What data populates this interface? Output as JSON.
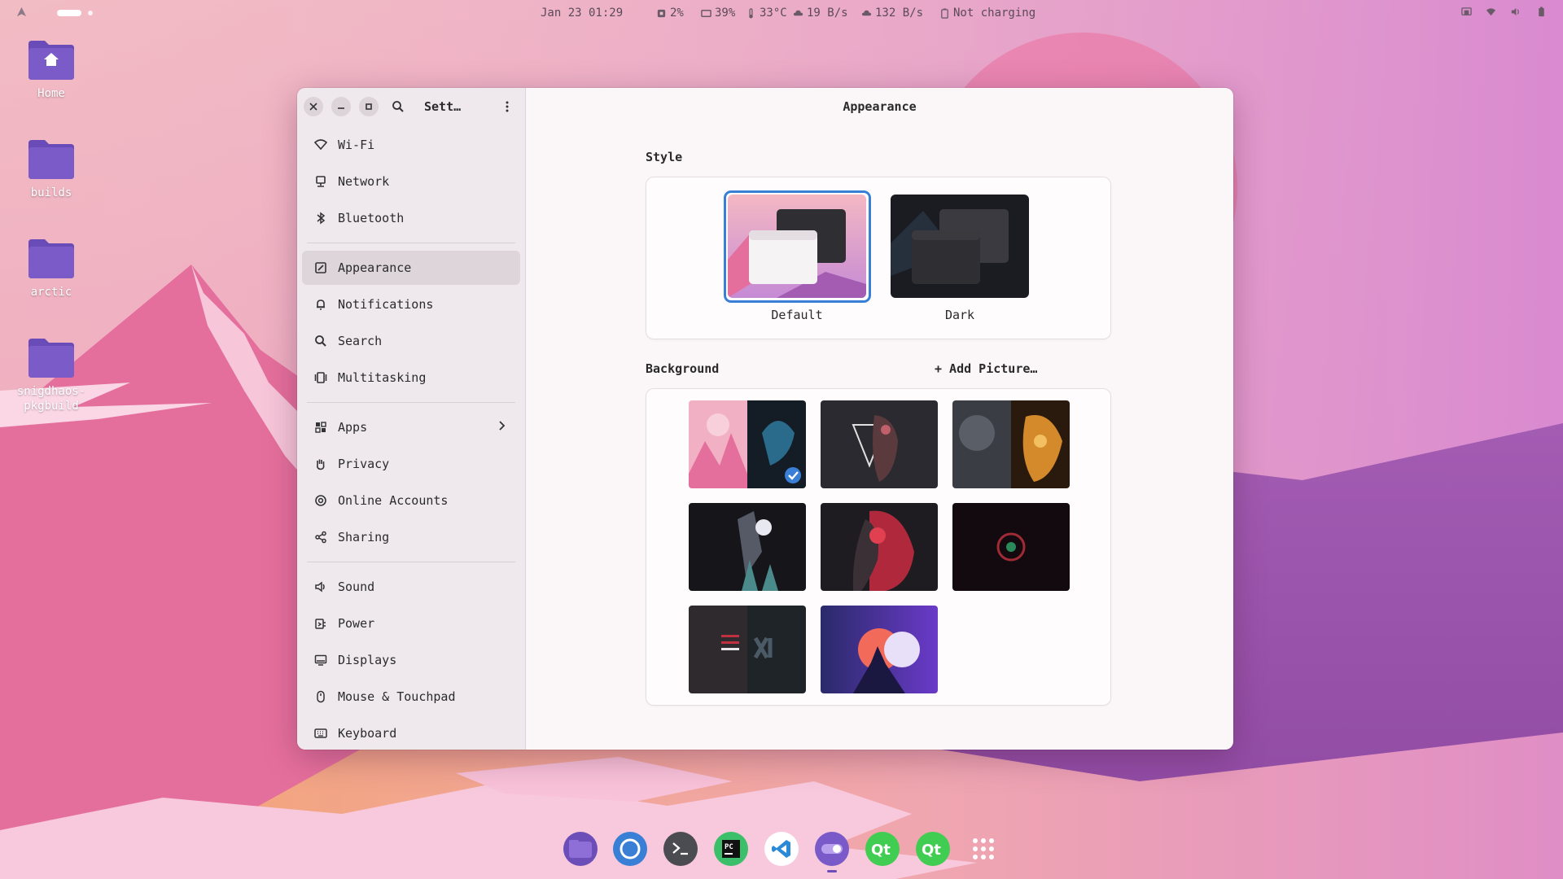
{
  "topbar": {
    "datetime": "Jan 23 01:29",
    "cpu": "2%",
    "memory": "39%",
    "temperature": "33°C",
    "download": "19 B/s",
    "upload": "132 B/s",
    "battery_status": "Not charging"
  },
  "desktop": {
    "icons": [
      {
        "label": "Home"
      },
      {
        "label": "builds"
      },
      {
        "label": "arctic"
      },
      {
        "label": "snigdhaos-\npkgbuild"
      }
    ]
  },
  "sidebar": {
    "title": "Sett…",
    "items": [
      {
        "label": "Wi-Fi",
        "icon": "wifi-icon"
      },
      {
        "label": "Network",
        "icon": "network-icon"
      },
      {
        "label": "Bluetooth",
        "icon": "bluetooth-icon"
      },
      {
        "label": "Appearance",
        "icon": "appearance-icon"
      },
      {
        "label": "Notifications",
        "icon": "bell-icon"
      },
      {
        "label": "Search",
        "icon": "search-icon"
      },
      {
        "label": "Multitasking",
        "icon": "multitasking-icon"
      },
      {
        "label": "Apps",
        "icon": "apps-icon"
      },
      {
        "label": "Privacy",
        "icon": "hand-icon"
      },
      {
        "label": "Online Accounts",
        "icon": "at-icon"
      },
      {
        "label": "Sharing",
        "icon": "share-icon"
      },
      {
        "label": "Sound",
        "icon": "speaker-icon"
      },
      {
        "label": "Power",
        "icon": "power-icon"
      },
      {
        "label": "Displays",
        "icon": "display-icon"
      },
      {
        "label": "Mouse & Touchpad",
        "icon": "mouse-icon"
      },
      {
        "label": "Keyboard",
        "icon": "keyboard-icon"
      }
    ]
  },
  "content": {
    "title": "Appearance",
    "style": {
      "heading": "Style",
      "options": [
        {
          "label": "Default",
          "selected": true
        },
        {
          "label": "Dark",
          "selected": false
        }
      ]
    },
    "background": {
      "heading": "Background",
      "add_picture": "+ Add Picture…",
      "thumbnail_count": 8,
      "selected_index": 0
    }
  },
  "colors": {
    "accent": "#3a7fd6",
    "folder": "#7b5bc8",
    "sidebar_bg": "#efe9ed",
    "content_bg": "#fbf7f9"
  }
}
